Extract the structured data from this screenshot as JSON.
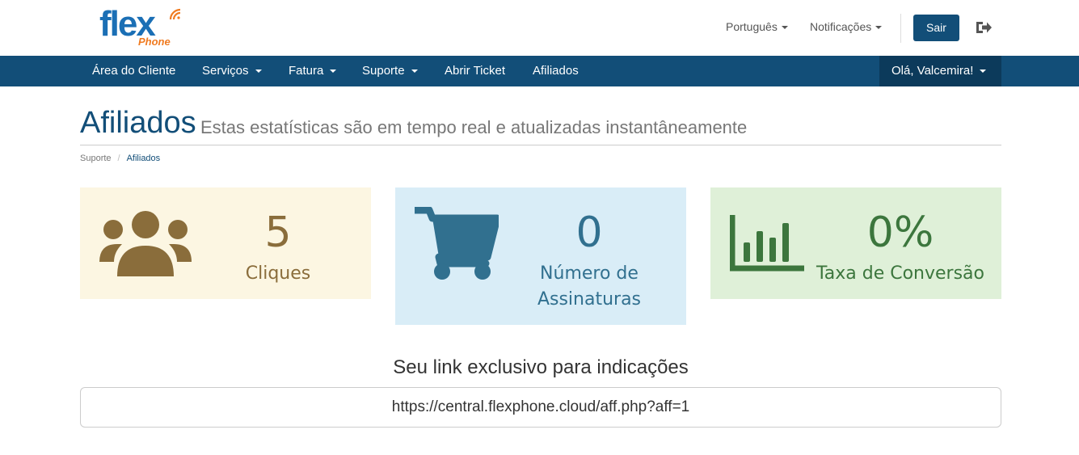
{
  "logo": {
    "text": "flex",
    "sub": "Phone"
  },
  "header": {
    "language": "Português",
    "notifications": "Notificações",
    "logout_button": "Sair"
  },
  "nav": {
    "items": [
      {
        "label": "Área do Cliente",
        "dropdown": false
      },
      {
        "label": "Serviços",
        "dropdown": true
      },
      {
        "label": "Fatura",
        "dropdown": true
      },
      {
        "label": "Suporte",
        "dropdown": true
      },
      {
        "label": "Abrir Ticket",
        "dropdown": false
      },
      {
        "label": "Afiliados",
        "dropdown": false
      }
    ],
    "user": "Olá, Valcemira!"
  },
  "page": {
    "title": "Afiliados",
    "subtitle": "Estas estatísticas são em tempo real e atualizadas instantâneamente"
  },
  "breadcrumb": {
    "parent": "Suporte",
    "current": "Afiliados"
  },
  "stats": {
    "clicks": {
      "value": "5",
      "label": "Cliques",
      "icon": "users-icon",
      "color": "#8a6d3b"
    },
    "subscriptions": {
      "value": "0",
      "label": "Número de Assinaturas",
      "icon": "shopping-cart-icon",
      "color": "#31708f"
    },
    "conversion": {
      "value": "0%",
      "label": "Taxa de Conversão",
      "icon": "bar-chart-icon",
      "color": "#3c763d"
    }
  },
  "referral": {
    "title": "Seu link exclusivo para indicações",
    "link": "https://central.flexphone.cloud/aff.php?aff=1"
  },
  "colors": {
    "brand": "#124e78",
    "logo_blue": "#1b6fb5",
    "logo_orange": "#f07b21"
  }
}
